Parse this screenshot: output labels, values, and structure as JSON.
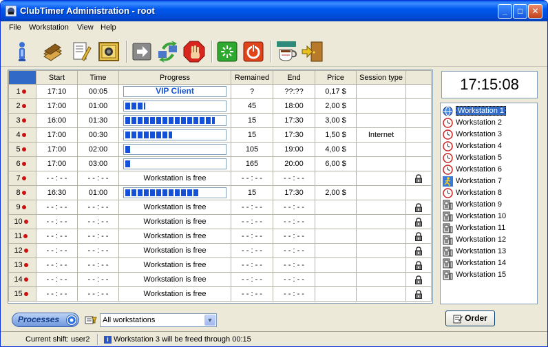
{
  "window": {
    "title": "ClubTimer Administration - root"
  },
  "menu": [
    "File",
    "Workstation",
    "View",
    "Help"
  ],
  "table": {
    "headers": [
      "",
      "Start",
      "Time",
      "Progress",
      "Remained",
      "End",
      "Price",
      "Session type",
      ""
    ],
    "rows": [
      {
        "num": "1",
        "start": "17:10",
        "time": "00:05",
        "progress_text": "VIP Client",
        "progress": 0,
        "remained": "?",
        "end": "??:??",
        "price": "0,17 $",
        "session": "",
        "locked": false
      },
      {
        "num": "2",
        "start": "17:00",
        "time": "01:00",
        "progress_text": "",
        "progress": 0.2,
        "remained": "45",
        "end": "18:00",
        "price": "2,00 $",
        "session": "",
        "locked": false
      },
      {
        "num": "3",
        "start": "16:00",
        "time": "01:30",
        "progress_text": "",
        "progress": 0.9,
        "remained": "15",
        "end": "17:30",
        "price": "3,00 $",
        "session": "",
        "locked": false
      },
      {
        "num": "4",
        "start": "17:00",
        "time": "00:30",
        "progress_text": "",
        "progress": 0.47,
        "remained": "15",
        "end": "17:30",
        "price": "1,50 $",
        "session": "Internet",
        "locked": false
      },
      {
        "num": "5",
        "start": "17:00",
        "time": "02:00",
        "progress_text": "",
        "progress": 0.05,
        "remained": "105",
        "end": "19:00",
        "price": "4,00 $",
        "session": "",
        "locked": false
      },
      {
        "num": "6",
        "start": "17:00",
        "time": "03:00",
        "progress_text": "",
        "progress": 0.05,
        "remained": "165",
        "end": "20:00",
        "price": "6,00 $",
        "session": "",
        "locked": false
      },
      {
        "num": "7",
        "start": "- - : - -",
        "time": "- - : - -",
        "progress_text": "Workstation is free",
        "progress": 0,
        "remained": "- - : - -",
        "end": "- - : - -",
        "price": "",
        "session": "",
        "locked": true
      },
      {
        "num": "8",
        "start": "16:30",
        "time": "01:00",
        "progress_text": "",
        "progress": 0.75,
        "remained": "15",
        "end": "17:30",
        "price": "2,00 $",
        "session": "",
        "locked": false
      },
      {
        "num": "9",
        "start": "- - : - -",
        "time": "- - : - -",
        "progress_text": "Workstation is free",
        "progress": 0,
        "remained": "- - : - -",
        "end": "- - : - -",
        "price": "",
        "session": "",
        "locked": true
      },
      {
        "num": "10",
        "start": "- - : - -",
        "time": "- - : - -",
        "progress_text": "Workstation is free",
        "progress": 0,
        "remained": "- - : - -",
        "end": "- - : - -",
        "price": "",
        "session": "",
        "locked": true
      },
      {
        "num": "11",
        "start": "- - : - -",
        "time": "- - : - -",
        "progress_text": "Workstation is free",
        "progress": 0,
        "remained": "- - : - -",
        "end": "- - : - -",
        "price": "",
        "session": "",
        "locked": true
      },
      {
        "num": "12",
        "start": "- - : - -",
        "time": "- - : - -",
        "progress_text": "Workstation is free",
        "progress": 0,
        "remained": "- - : - -",
        "end": "- - : - -",
        "price": "",
        "session": "",
        "locked": true
      },
      {
        "num": "13",
        "start": "- - : - -",
        "time": "- - : - -",
        "progress_text": "Workstation is free",
        "progress": 0,
        "remained": "- - : - -",
        "end": "- - : - -",
        "price": "",
        "session": "",
        "locked": true
      },
      {
        "num": "14",
        "start": "- - : - -",
        "time": "- - : - -",
        "progress_text": "Workstation is free",
        "progress": 0,
        "remained": "- - : - -",
        "end": "- - : - -",
        "price": "",
        "session": "",
        "locked": true
      },
      {
        "num": "15",
        "start": "- - : - -",
        "time": "- - : - -",
        "progress_text": "Workstation is free",
        "progress": 0,
        "remained": "- - : - -",
        "end": "- - : - -",
        "price": "",
        "session": "",
        "locked": true
      }
    ]
  },
  "clock": "17:15:08",
  "workstations": [
    {
      "label": "Workstation 1",
      "icon": "globe-icon",
      "selected": true
    },
    {
      "label": "Workstation 2",
      "icon": "clock-icon",
      "selected": false
    },
    {
      "label": "Workstation 3",
      "icon": "clock-icon",
      "selected": false
    },
    {
      "label": "Workstation 4",
      "icon": "clock-icon",
      "selected": false
    },
    {
      "label": "Workstation 5",
      "icon": "clock-icon",
      "selected": false
    },
    {
      "label": "Workstation 6",
      "icon": "clock-icon",
      "selected": false
    },
    {
      "label": "Workstation 7",
      "icon": "runner-icon",
      "selected": false
    },
    {
      "label": "Workstation 8",
      "icon": "clock-icon",
      "selected": false
    },
    {
      "label": "Workstation 9",
      "icon": "computer-icon",
      "selected": false
    },
    {
      "label": "Workstation 10",
      "icon": "computer-icon",
      "selected": false
    },
    {
      "label": "Workstation 11",
      "icon": "computer-icon",
      "selected": false
    },
    {
      "label": "Workstation 12",
      "icon": "computer-icon",
      "selected": false
    },
    {
      "label": "Workstation 13",
      "icon": "computer-icon",
      "selected": false
    },
    {
      "label": "Workstation 14",
      "icon": "computer-icon",
      "selected": false
    },
    {
      "label": "Workstation 15",
      "icon": "computer-icon",
      "selected": false
    }
  ],
  "controls": {
    "processes_label": "Processes",
    "filter_value": "All workstations",
    "order_label": "Order"
  },
  "status": {
    "shift": "Current shift:  user2",
    "message": "Workstation 3 will be freed through 00:15"
  },
  "colors": {
    "title_bar": "#0058ee",
    "progress": "#1450d8",
    "status_dot": "#cc1111",
    "selection": "#316ac5"
  }
}
